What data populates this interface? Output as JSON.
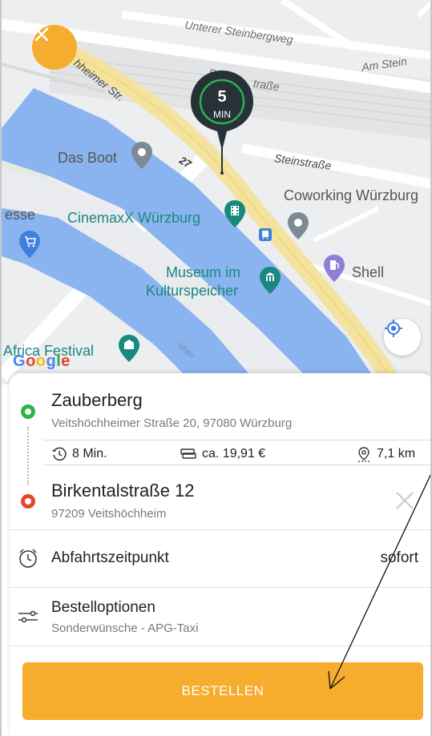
{
  "map": {
    "streets": {
      "unterer_steinbergweg": "Unterer Steinbergweg",
      "am_stein": "Am Stein",
      "veitshoechheimer_str": "hheimer Str.",
      "steinbachstrasse_partial": "Stä",
      "strasse_partial": "traße",
      "steinstrasse": "Steinstraße",
      "route_number": "27",
      "main_river": "Main"
    },
    "pois": {
      "das_boot": "Das Boot",
      "coworking": "Coworking Würzburg",
      "esse": "esse",
      "cinemaxx": "CinemaxX Würzburg",
      "shell": "Shell",
      "museum_line1": "Museum im",
      "museum_line2": "Kulturspeicher",
      "africa_festival": "Africa Festival"
    },
    "eta": {
      "value": "5",
      "unit": "MIN"
    },
    "google_logo": [
      "G",
      "o",
      "o",
      "g",
      "l",
      "e"
    ],
    "close_icon": "close-icon",
    "locate_icon": "my-location-icon"
  },
  "trip": {
    "origin": {
      "title": "Zauberberg",
      "address": "Veitshöchheimer Straße 20, 97080 Würzburg"
    },
    "stats": {
      "duration": "8 Min.",
      "price": "ca. 19,91 €",
      "distance": "7,1 km"
    },
    "destination": {
      "title": "Birkentalstraße 12",
      "address": "97209 Veitshöchheim"
    }
  },
  "options": {
    "departure": {
      "label": "Abfahrtszeitpunkt",
      "value": "sofort"
    },
    "order_options": {
      "label": "Bestelloptionen",
      "sub": "Sonderwünsche - APG-Taxi"
    }
  },
  "order_button": {
    "label": "BESTELLEN"
  },
  "colors": {
    "accent": "#f6ad2e",
    "origin_dot": "#2cb34a",
    "destination_dot": "#e8452c",
    "poi_teal": "#19887e",
    "water": "#8ab4f0"
  }
}
